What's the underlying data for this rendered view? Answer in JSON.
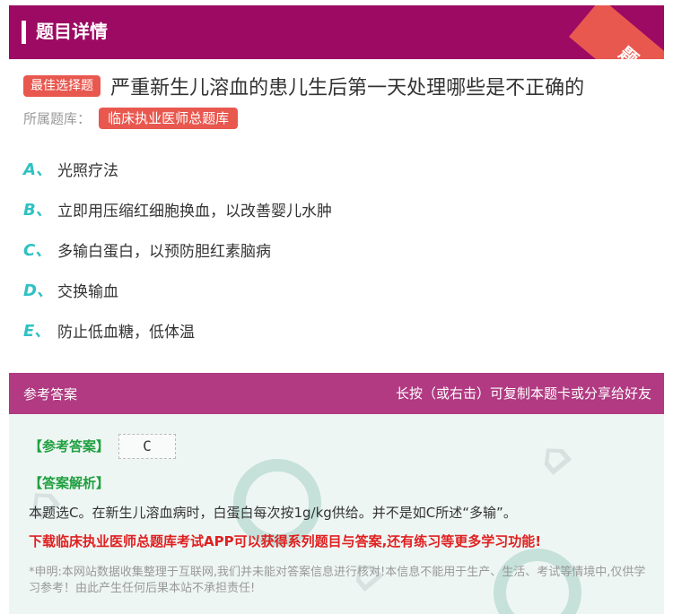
{
  "header": {
    "title": "题目详情",
    "ribbon": "题卡"
  },
  "question": {
    "badge": "最佳选择题",
    "text": "严重新生儿溶血的患儿生后第一天处理哪些是不正确的",
    "bank_label": "所属题库：",
    "bank_name": "临床执业医师总题库"
  },
  "options": [
    {
      "letter": "A、",
      "text": "光照疗法"
    },
    {
      "letter": "B、",
      "text": "立即用压缩红细胞换血，以改善婴儿水肿"
    },
    {
      "letter": "C、",
      "text": "多输白蛋白，以预防胆红素脑病"
    },
    {
      "letter": "D、",
      "text": "交换输血"
    },
    {
      "letter": "E、",
      "text": "防止低血糖，低体温"
    }
  ],
  "answer": {
    "header_left": "参考答案",
    "header_right": "长按（或右击）可复制本题卡或分享给好友",
    "answer_label": "【参考答案】",
    "answer_value": "C",
    "analysis_label": "【答案解析】",
    "analysis_text": "本题选C。在新生儿溶血病时，白蛋白每次按1g/kg供给。并不是如C所述“多输”。",
    "promo": "下载临床执业医师总题库考试APP可以获得系列题目与答案,还有练习等更多学习功能!",
    "disclaimer": "*申明:本网站数据收集整理于互联网,我们并未能对答案信息进行核对!本信息不能用于生产、生活、考试等情境中,仅供学习参考！由此产生任何后果本站不承担责任!"
  },
  "colors": {
    "header_bg": "#9c0a63",
    "answer_header_bg": "#b13a82",
    "badge_bg": "#e8584f",
    "option_letter": "#2ec1c3",
    "answer_label": "#20a040",
    "promo": "#e02020"
  }
}
